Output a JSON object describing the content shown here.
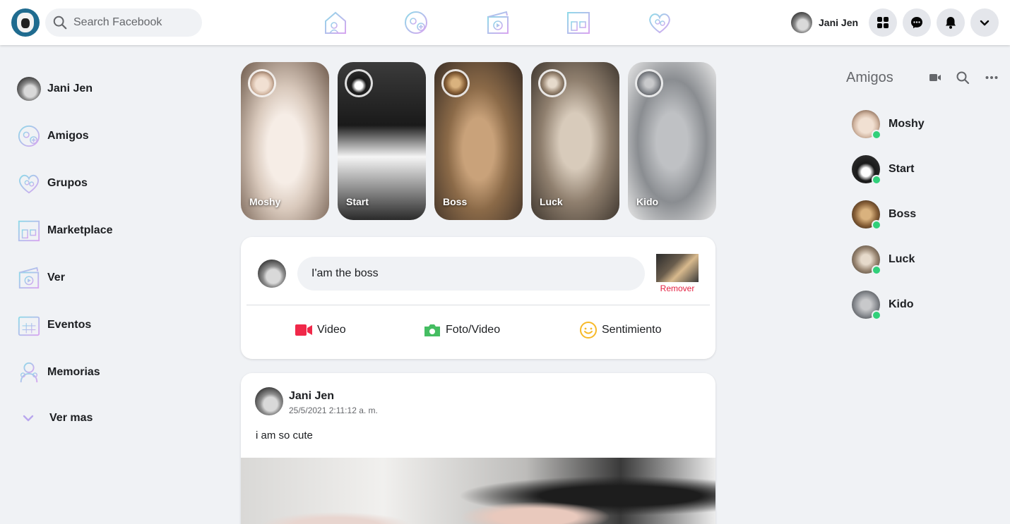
{
  "header": {
    "search_placeholder": "Search Facebook",
    "nav_icons": [
      "home-icon",
      "friends-icon",
      "watch-icon",
      "marketplace-icon",
      "groups-icon"
    ],
    "profile_name": "Jani Jen",
    "action_icons": [
      "menu-grid-icon",
      "messenger-icon",
      "notifications-icon",
      "account-dropdown-icon"
    ]
  },
  "sidebar": {
    "profile_name": "Jani Jen",
    "items": [
      {
        "label": "Amigos",
        "icon": "friends-icon"
      },
      {
        "label": "Grupos",
        "icon": "groups-icon"
      },
      {
        "label": "Marketplace",
        "icon": "marketplace-icon"
      },
      {
        "label": "Ver",
        "icon": "watch-icon"
      },
      {
        "label": "Eventos",
        "icon": "calendar-icon"
      },
      {
        "label": "Memorias",
        "icon": "memories-icon"
      }
    ],
    "see_more": "Ver mas"
  },
  "stories": [
    {
      "name": "Moshy"
    },
    {
      "name": "Start"
    },
    {
      "name": "Boss"
    },
    {
      "name": "Luck"
    },
    {
      "name": "Kido"
    }
  ],
  "composer": {
    "value": "I'am the boss",
    "remove_label": "Remover",
    "actions": [
      {
        "label": "Video",
        "icon": "video-camera-icon",
        "color": "#f02849"
      },
      {
        "label": "Foto/Video",
        "icon": "camera-icon",
        "color": "#45bd62"
      },
      {
        "label": "Sentimiento",
        "icon": "smiley-icon",
        "color": "#f7b928"
      }
    ]
  },
  "post": {
    "author": "Jani Jen",
    "timestamp": "25/5/2021 2:11:12 a. m.",
    "text": "i am so cute"
  },
  "contacts": {
    "title": "Amigos",
    "icons": [
      "video-call-icon",
      "search-icon",
      "more-icon"
    ],
    "list": [
      {
        "name": "Moshy",
        "online": true
      },
      {
        "name": "Start",
        "online": true
      },
      {
        "name": "Boss",
        "online": true
      },
      {
        "name": "Luck",
        "online": true
      },
      {
        "name": "Kido",
        "online": true
      }
    ]
  },
  "colors": {
    "background": "#f0f2f5",
    "online": "#31d07a",
    "remove": "#e41e3f",
    "icon_gradient_start": "#9ad8e6",
    "icon_gradient_end": "#d9a6f2"
  }
}
